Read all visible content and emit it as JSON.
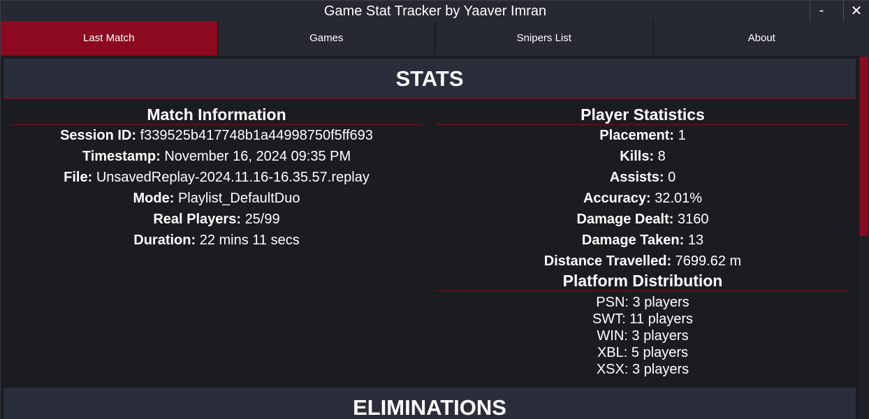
{
  "window": {
    "title": "Game Stat Tracker by Yaaver Imran",
    "minimize_label": "-",
    "close_label": "✕"
  },
  "tabs": [
    {
      "label": "Last Match",
      "active": true
    },
    {
      "label": "Games",
      "active": false
    },
    {
      "label": "Snipers List",
      "active": false
    },
    {
      "label": "About",
      "active": false
    }
  ],
  "stats": {
    "header": "STATS",
    "match_info": {
      "title": "Match Information",
      "rows": [
        {
          "label": "Session ID:",
          "value": "f339525b417748b1a44998750f5ff693"
        },
        {
          "label": "Timestamp:",
          "value": "November 16, 2024 09:35 PM"
        },
        {
          "label": "File:",
          "value": "UnsavedReplay-2024.11.16-16.35.57.replay"
        },
        {
          "label": "Mode:",
          "value": "Playlist_DefaultDuo"
        },
        {
          "label": "Real Players:",
          "value": "25/99"
        },
        {
          "label": "Duration:",
          "value": "22 mins 11 secs"
        }
      ]
    },
    "player_stats": {
      "title": "Player Statistics",
      "rows": [
        {
          "label": "Placement:",
          "value": "1"
        },
        {
          "label": "Kills:",
          "value": "8"
        },
        {
          "label": "Assists:",
          "value": "0"
        },
        {
          "label": "Accuracy:",
          "value": "32.01%"
        },
        {
          "label": "Damage Dealt:",
          "value": "3160"
        },
        {
          "label": "Damage Taken:",
          "value": "13"
        },
        {
          "label": "Distance Travelled:",
          "value": "7699.62 m"
        }
      ]
    },
    "platform_distribution": {
      "title": "Platform Distribution",
      "items": [
        "PSN: 3 players",
        "SWT: 11 players",
        "WIN: 3 players",
        "XBL: 5 players",
        "XSX: 3 players"
      ]
    }
  },
  "eliminations": {
    "header": "ELIMINATIONS"
  },
  "colors": {
    "accent": "#8b0a1f",
    "background": "#1b1c20",
    "panel": "#2a2d3a"
  }
}
